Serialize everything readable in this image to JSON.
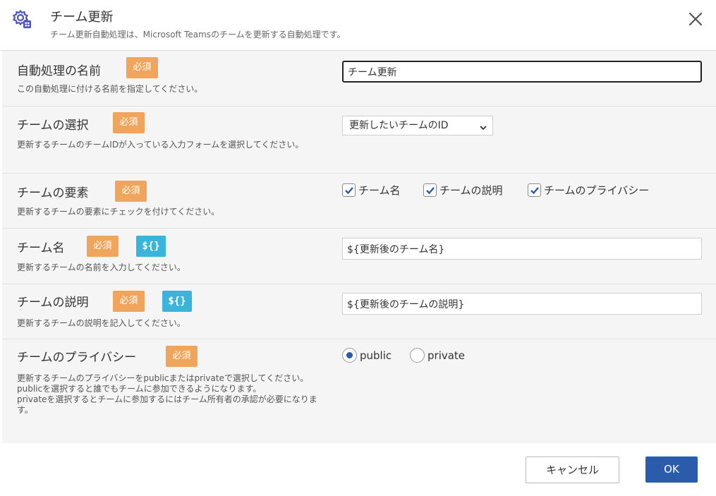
{
  "header": {
    "title": "チーム更新",
    "subtitle": "チーム更新自動処理は、Microsoft Teamsのチームを更新する自動処理です。",
    "icon": "gear-settings-icon",
    "close_icon": "close-icon"
  },
  "badges": {
    "required": "必須",
    "variable": "${}"
  },
  "fields": {
    "name": {
      "label": "自動処理の名前",
      "desc": "この自動処理に付ける名前を指定してください。",
      "value": "チーム更新"
    },
    "team_select": {
      "label": "チームの選択",
      "desc": "更新するチームのチームIDが入っている入力フォームを選択してください。",
      "selected": "更新したいチームのID"
    },
    "elements": {
      "label": "チームの要素",
      "desc": "更新するチームの要素にチェックを付けてください。",
      "options": [
        {
          "label": "チーム名",
          "checked": true
        },
        {
          "label": "チームの説明",
          "checked": true
        },
        {
          "label": "チームのプライバシー",
          "checked": true
        }
      ]
    },
    "team_name": {
      "label": "チーム名",
      "desc": "更新するチームの名前を入力してください。",
      "value": "${更新後のチーム名}"
    },
    "team_desc": {
      "label": "チームの説明",
      "desc": "更新するチームの説明を記入してください。",
      "value": "${更新後のチームの説明}"
    },
    "privacy": {
      "label": "チームのプライバシー",
      "desc_lines": [
        "更新するチームのプライバシーをpublicまたはprivateで選択してください。",
        "publicを選択すると誰でもチームに参加できるようになります。",
        "privateを選択するとチームに参加するにはチーム所有者の承認が必要になります。"
      ],
      "options": [
        {
          "label": "public",
          "selected": true
        },
        {
          "label": "private",
          "selected": false
        }
      ]
    }
  },
  "footer": {
    "cancel_label": "キャンセル",
    "ok_label": "OK"
  },
  "colors": {
    "required_badge": "#f0a55d",
    "variable_badge": "#3bb4d9",
    "primary": "#2b5cab",
    "icon": "#4a52c8"
  }
}
